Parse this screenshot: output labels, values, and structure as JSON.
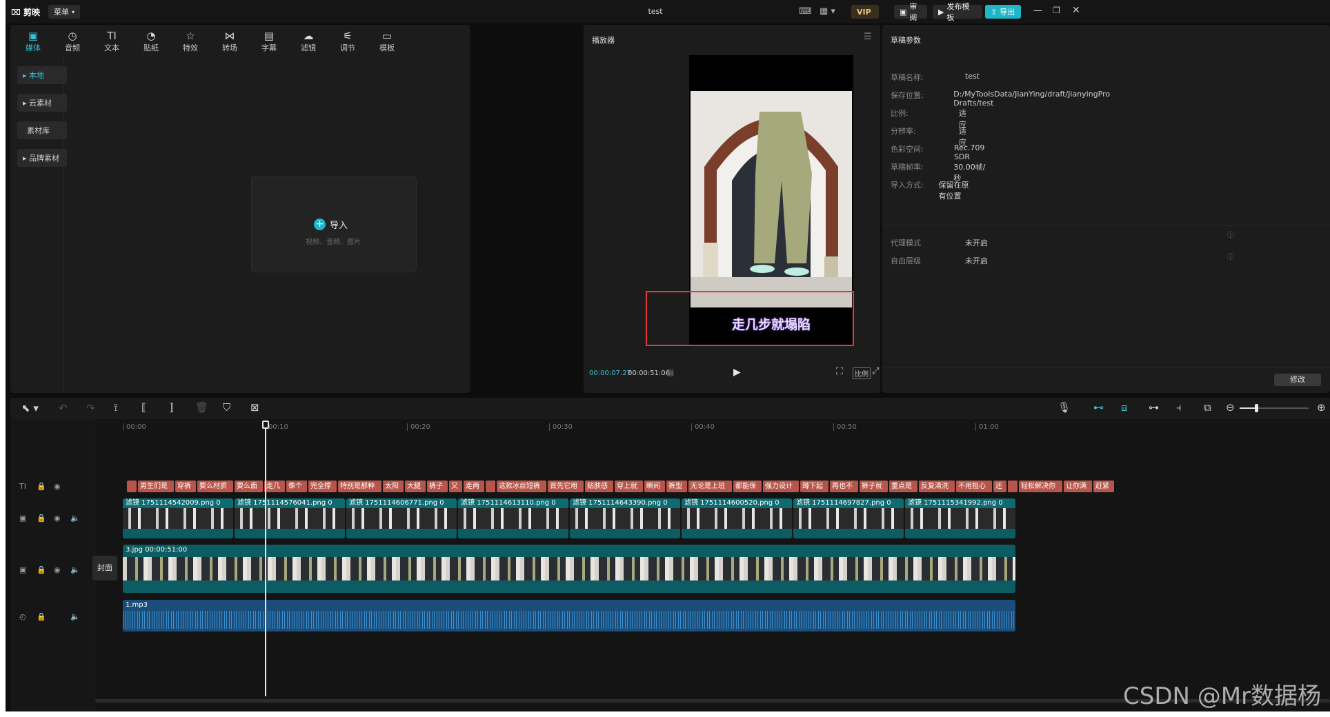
{
  "app": {
    "logo_text": "剪映",
    "menu_label": "菜单",
    "title": "test",
    "vip_label": "VIP",
    "review_label": "审阅",
    "publish_template_label": "发布模板",
    "export_label": "导出"
  },
  "toolbar": {
    "tabs": [
      {
        "label": "媒体",
        "icon": "media-icon",
        "glyph": "▣"
      },
      {
        "label": "音频",
        "icon": "audio-icon",
        "glyph": "◷"
      },
      {
        "label": "文本",
        "icon": "text-icon",
        "glyph": "TI"
      },
      {
        "label": "贴纸",
        "icon": "sticker-icon",
        "glyph": "◔"
      },
      {
        "label": "特效",
        "icon": "effects-icon",
        "glyph": "☆"
      },
      {
        "label": "转场",
        "icon": "transition-icon",
        "glyph": "⋈"
      },
      {
        "label": "字幕",
        "icon": "subtitle-icon",
        "glyph": "▤"
      },
      {
        "label": "滤镜",
        "icon": "filter-icon",
        "glyph": "☁"
      },
      {
        "label": "调节",
        "icon": "adjust-icon",
        "glyph": "⚟"
      },
      {
        "label": "模板",
        "icon": "template-icon",
        "glyph": "▭"
      }
    ]
  },
  "media_sidebar": {
    "items": [
      "▸ 本地",
      "▸ 云素材",
      "素材库",
      "▸ 品牌素材"
    ]
  },
  "import_box": {
    "label": "导入",
    "hint": "视频、音频、图片"
  },
  "player": {
    "title": "播放器",
    "subtitle_text": "走几步就塌陷",
    "current_time": "00:00:07:27",
    "total_time": "00:00:51:06",
    "ratio_label": "比例"
  },
  "draft_params": {
    "title": "草稿参数",
    "rows": [
      {
        "label": "草稿名称:",
        "value": "test"
      },
      {
        "label": "保存位置:",
        "value": "D:/MyToolsData/JianYing/draft/JianyingPro Drafts/test"
      },
      {
        "label": "比例:",
        "value": "适应"
      },
      {
        "label": "分辨率:",
        "value": "适应"
      },
      {
        "label": "色彩空间:",
        "value": "Rec.709 SDR"
      },
      {
        "label": "草稿帧率:",
        "value": "30.00帧/秒"
      },
      {
        "label": "导入方式:",
        "value": "保留在原有位置"
      }
    ],
    "rows2": [
      {
        "label": "代理模式",
        "value": "未开启"
      },
      {
        "label": "自由层级",
        "value": "未开启"
      }
    ],
    "edit_label": "修改"
  },
  "timeline": {
    "ticks": [
      "00:00",
      "00:10",
      "00:20",
      "00:30",
      "00:40",
      "00:50",
      "01:00"
    ],
    "text_segments": [
      "",
      "男生们是",
      "穿裤",
      "要么材质",
      "要么面",
      "走几",
      "像个",
      "完全撑",
      "特别是那种",
      "太阳",
      "大腿",
      "裤子",
      "又",
      "走两",
      "",
      "这款冰丝短裤",
      "首先它用",
      "贴肤感",
      "穿上就",
      "瞬间",
      "裤型",
      "无论是上班",
      "都能保",
      "强力设计",
      "蹲下起",
      "再也不",
      "裤子就",
      "重点是",
      "反复清洗",
      "不用担心",
      "还",
      "",
      "轻松解决你",
      "让你满",
      "赶紧"
    ],
    "image_clips": [
      "滤镜  1751114542009.png  0",
      "滤镜  1751114576041.png  0",
      "滤镜  1751114606771.png  0",
      "滤镜  1751114613110.png  0",
      "滤镜  1751114643390.png  0",
      "滤镜  1751114600520.png  0",
      "滤镜  1751114697827.png  0",
      "滤镜  1751115341992.png  0"
    ],
    "main_clip": "3.jpg  00:00:51:00",
    "cover_label": "封面",
    "audio_clip": "1.mp3"
  },
  "watermark": "CSDN @Mr数据杨"
}
